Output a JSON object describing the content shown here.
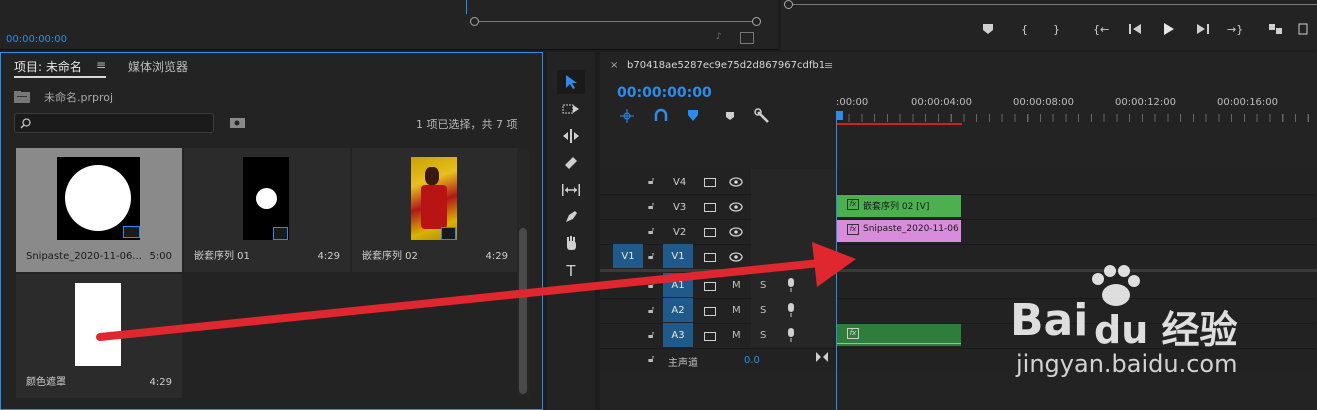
{
  "source_monitor": {
    "timecode": "00:00:00:00"
  },
  "project_panel": {
    "tab_active": "项目: 未命名",
    "tab_menu": "≡",
    "tab_other": "媒体浏览器",
    "file_name": "未命名.prproj",
    "search_placeholder": "",
    "selection_info": "1 项已选择，共 7 项",
    "items": [
      {
        "label": "Snipaste_2020-11-06...",
        "duration": "5:00"
      },
      {
        "label": "嵌套序列 01",
        "duration": "4:29"
      },
      {
        "label": "嵌套序列 02",
        "duration": "4:29"
      },
      {
        "label": "颜色遮罩",
        "duration": "4:29"
      }
    ]
  },
  "timeline": {
    "close": "×",
    "sequence_name": "b70418ae5287ec9e75d2d867967cdfb1",
    "menu": "≡",
    "timecode": "00:00:00:00",
    "ruler": [
      ":00:00",
      "00:00:04:00",
      "00:00:08:00",
      "00:00:12:00",
      "00:00:16:00"
    ],
    "video_tracks": [
      {
        "name": "V4",
        "source": ""
      },
      {
        "name": "V3",
        "source": ""
      },
      {
        "name": "V2",
        "source": ""
      },
      {
        "name": "V1",
        "source": "V1"
      }
    ],
    "audio_tracks": [
      {
        "name": "A1",
        "m": "M",
        "s": "S"
      },
      {
        "name": "A2",
        "m": "M",
        "s": "S"
      },
      {
        "name": "A3",
        "m": "M",
        "s": "S"
      }
    ],
    "master": {
      "label": "主声道",
      "value": "0.0"
    },
    "clips": {
      "v3": "嵌套序列 02 [V]",
      "v2": "Snipaste_2020-11-06",
      "a3": ""
    },
    "fx_label": "fx"
  },
  "watermark": {
    "line1": "Bai",
    "line2": "du 经验",
    "url": "jingyan.baidu.com"
  },
  "colors": {
    "accent": "#2d8ceb",
    "clip_green": "#4caf50",
    "clip_pink": "#d98bdc",
    "audio_clip": "#2f7d3a",
    "arrow": "#e0262e"
  }
}
